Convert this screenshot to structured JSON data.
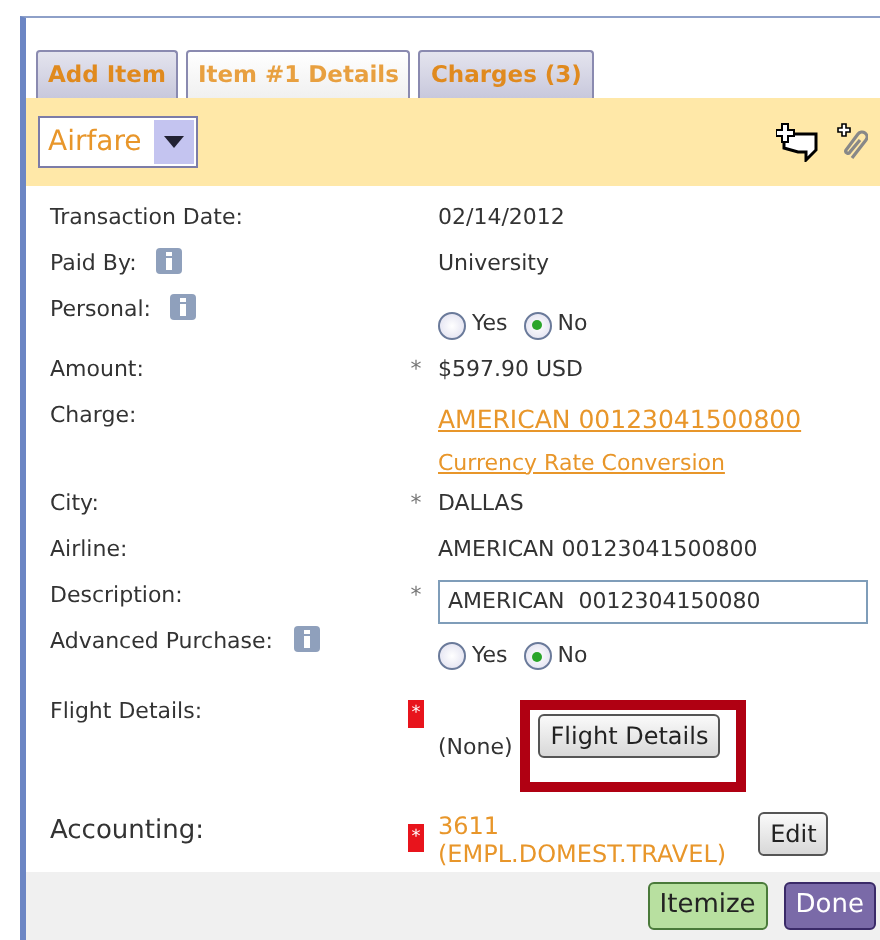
{
  "tabs": [
    {
      "label": "Add Item",
      "selected": false
    },
    {
      "label": "Item #1 Details",
      "selected": true
    },
    {
      "label": "Charges (3)",
      "selected": false
    }
  ],
  "expense_type": {
    "value": "Airfare"
  },
  "fields": [
    {
      "kind": "text",
      "label": "Transaction Date:",
      "info": false,
      "value": "02/14/2012"
    },
    {
      "kind": "text",
      "label": "Paid By:",
      "info": true,
      "value": "University"
    },
    {
      "kind": "radio",
      "label": "Personal:",
      "info": true,
      "options": [
        {
          "label": "Yes",
          "selected": false
        },
        {
          "label": "No",
          "selected": true
        }
      ]
    },
    {
      "kind": "text",
      "label": "Amount:",
      "info": false,
      "marker": {
        "text": "*",
        "kind": "plain"
      },
      "value": "$597.90 USD"
    },
    {
      "kind": "links",
      "label": "Charge:",
      "info": false,
      "links": [
        "AMERICAN 00123041500800",
        "Currency Rate Conversion"
      ]
    },
    {
      "kind": "text",
      "label": "City:",
      "info": false,
      "marker": {
        "text": "*",
        "kind": "plain"
      },
      "value": "DALLAS"
    },
    {
      "kind": "text",
      "label": "Airline:",
      "info": false,
      "value": "AMERICAN 00123041500800"
    },
    {
      "kind": "input",
      "label": "Description:",
      "info": false,
      "marker": {
        "text": "*",
        "kind": "plain"
      },
      "value": "AMERICAN  0012304150080"
    },
    {
      "kind": "radio",
      "label": "Advanced Purchase:",
      "info": true,
      "options": [
        {
          "label": "Yes",
          "selected": false
        },
        {
          "label": "No",
          "selected": true
        }
      ]
    },
    {
      "kind": "button",
      "label": "Flight Details:",
      "info": false,
      "marker": {
        "text": "*",
        "kind": "flag"
      },
      "value": "(None)",
      "button": "Flight Details",
      "highlighted": true
    },
    {
      "kind": "account",
      "label": "Accounting:",
      "info": false,
      "marker": {
        "text": "*",
        "kind": "flag"
      },
      "lines": [
        "3611",
        "(EMPL.DOMEST.TRAVEL)"
      ],
      "button": "Edit"
    }
  ],
  "footer_buttons": [
    {
      "label": "Itemize",
      "kind": "green"
    },
    {
      "label": "Done",
      "kind": "purple"
    }
  ]
}
